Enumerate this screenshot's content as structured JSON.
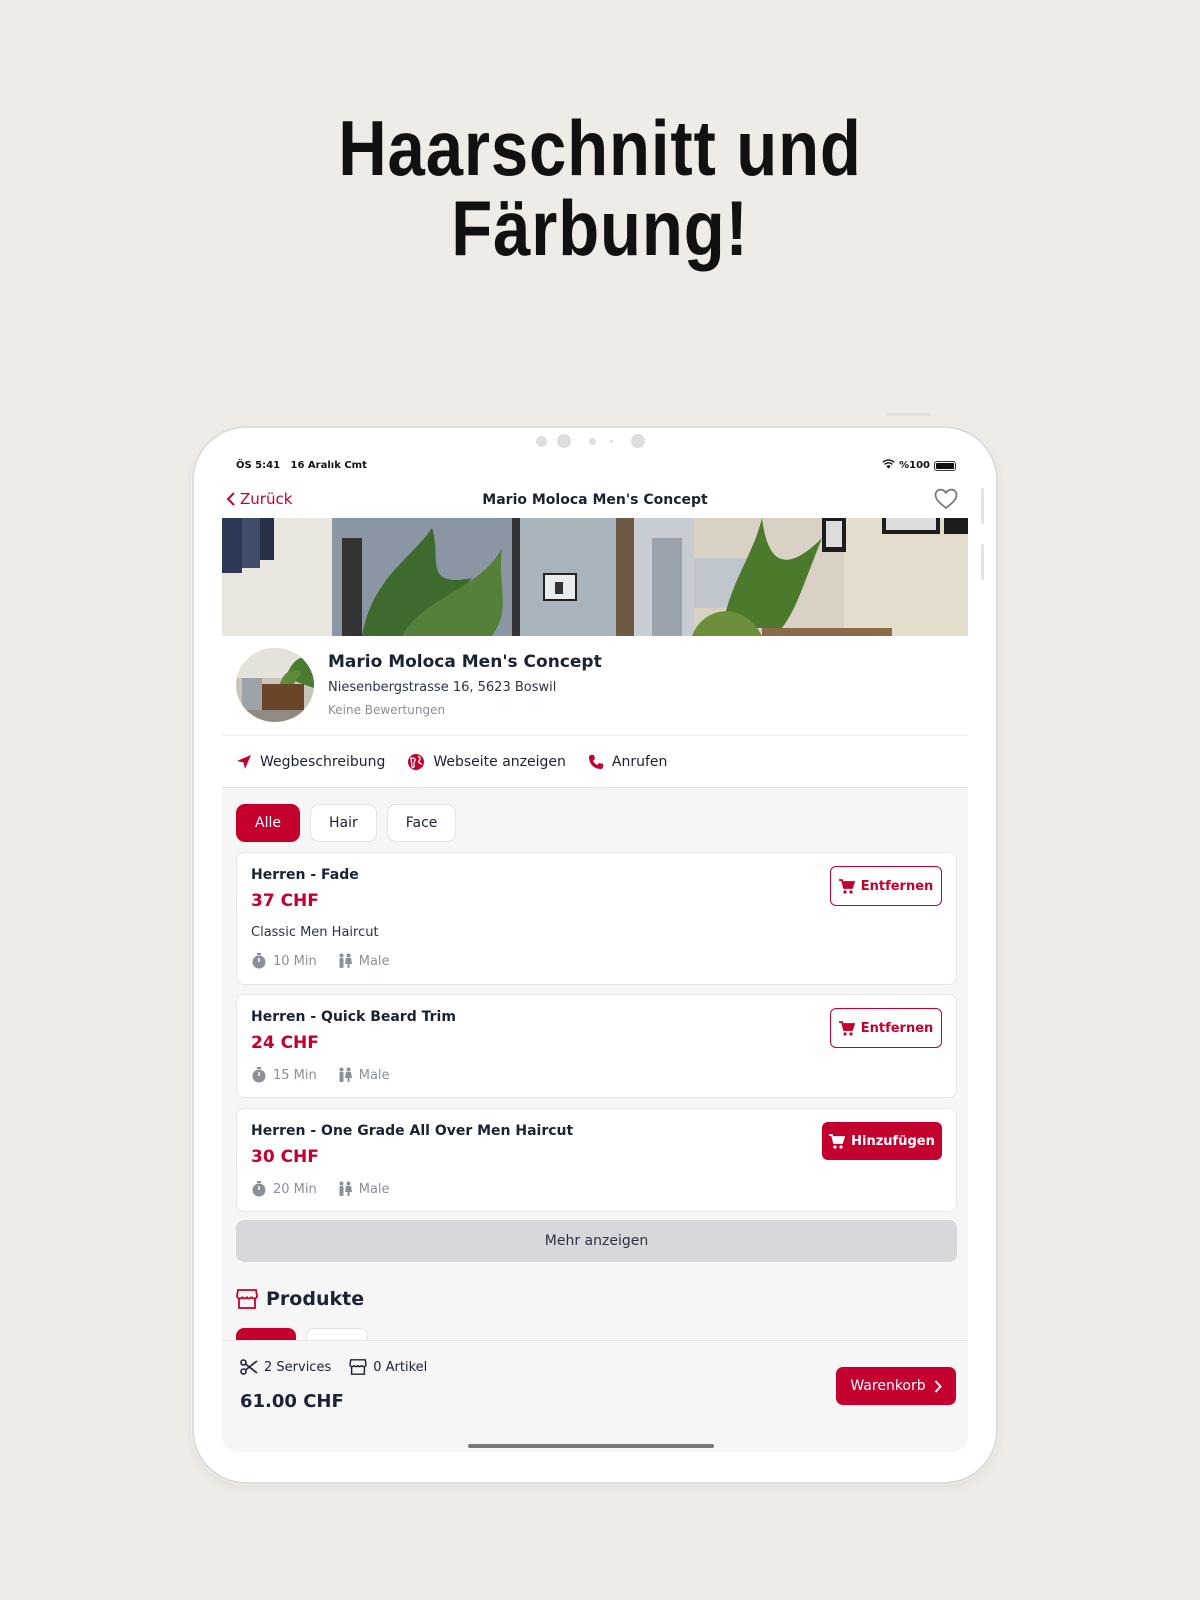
{
  "headline": {
    "line1": "Haarschnitt und",
    "line2": "Färbung!"
  },
  "statusbar": {
    "time": "ÖS 5:41",
    "date": "16 Aralık Cmt",
    "battery": "%100"
  },
  "navbar": {
    "back_label": "Zurück",
    "title": "Mario Moloca Men's Concept",
    "favorite_icon": "heart-outline-icon"
  },
  "shop": {
    "name": "Mario Moloca Men's Concept",
    "address": "Niesenbergstrasse 16, 5623 Boswil",
    "rating": "Keine Bewertungen"
  },
  "actions": [
    {
      "label": "Wegbeschreibung",
      "icon": "navigation-arrow-icon"
    },
    {
      "label": "Webseite anzeigen",
      "icon": "globe-icon"
    },
    {
      "label": "Anrufen",
      "icon": "phone-icon"
    }
  ],
  "filters": [
    {
      "label": "Alle",
      "active": true
    },
    {
      "label": "Hair",
      "active": false
    },
    {
      "label": "Face",
      "active": false
    }
  ],
  "services": [
    {
      "name": "Herren - Fade",
      "price": "37 CHF",
      "description": "Classic Men Haircut",
      "duration": "10 Min",
      "gender": "Male",
      "button": "Entfernen",
      "in_cart": true
    },
    {
      "name": "Herren - Quick Beard Trim",
      "price": "24 CHF",
      "description": "",
      "duration": "15 Min",
      "gender": "Male",
      "button": "Entfernen",
      "in_cart": true
    },
    {
      "name": "Herren - One Grade All Over Men Haircut",
      "price": "30 CHF",
      "description": "",
      "duration": "20 Min",
      "gender": "Male",
      "button": "Hinzufügen",
      "in_cart": false
    }
  ],
  "more_label": "Mehr anzeigen",
  "products": {
    "title": "Produkte",
    "icon": "store-icon"
  },
  "cart": {
    "services_count": "2 Services",
    "articles_count": "0 Artikel",
    "total": "61.00 CHF",
    "button": "Warenkorb"
  },
  "colors": {
    "accent": "#c4002f",
    "text": "#1b2235",
    "muted": "#8a8f99",
    "background": "#efece7"
  }
}
